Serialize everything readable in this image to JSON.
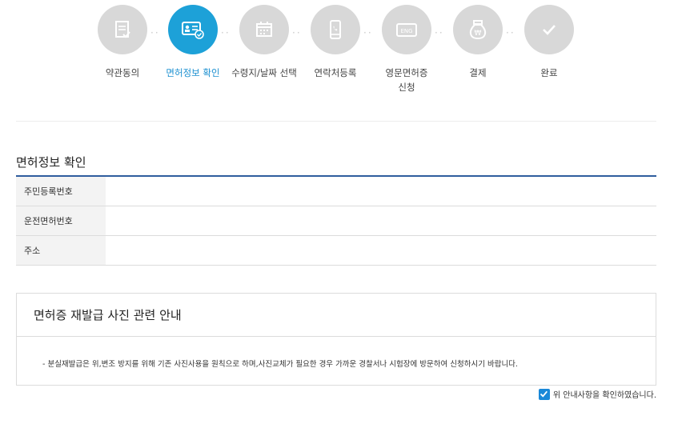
{
  "stepper": {
    "steps": [
      {
        "label": "약관동의",
        "icon": "document-check-icon",
        "active": false
      },
      {
        "label": "면허정보 확인",
        "icon": "id-card-icon",
        "active": true
      },
      {
        "label": "수령지/날짜 선택",
        "icon": "calendar-icon",
        "active": false
      },
      {
        "label": "연락처등록",
        "icon": "phone-icon",
        "active": false
      },
      {
        "label": "영문면허증",
        "label2": "신청",
        "icon": "english-license-icon",
        "active": false
      },
      {
        "label": "결제",
        "icon": "money-bag-won-icon",
        "active": false
      },
      {
        "label": "완료",
        "icon": "check-icon",
        "active": false
      }
    ],
    "colors": {
      "active": "#1da1d8",
      "inactive": "#d8d8d8",
      "active_text": "#1a8fd0"
    }
  },
  "license_info": {
    "title": "면허정보 확인",
    "rows": [
      {
        "label": "주민등록번호",
        "value": ""
      },
      {
        "label": "운전면허번호",
        "value": ""
      },
      {
        "label": "주소",
        "value": ""
      }
    ]
  },
  "notice": {
    "title": "면허증 재발급 사진 관련 안내",
    "body": "- 분실재발급은 위,변조 방지를 위해 기존 사진사용을 원칙으로 하며,사진교체가 필요한 경우 가까운 경찰서나 시험장에 방문하여 신청하시기 바랍니다."
  },
  "confirm": {
    "label": "위 안내사항을 확인하였습니다.",
    "checked": true
  }
}
